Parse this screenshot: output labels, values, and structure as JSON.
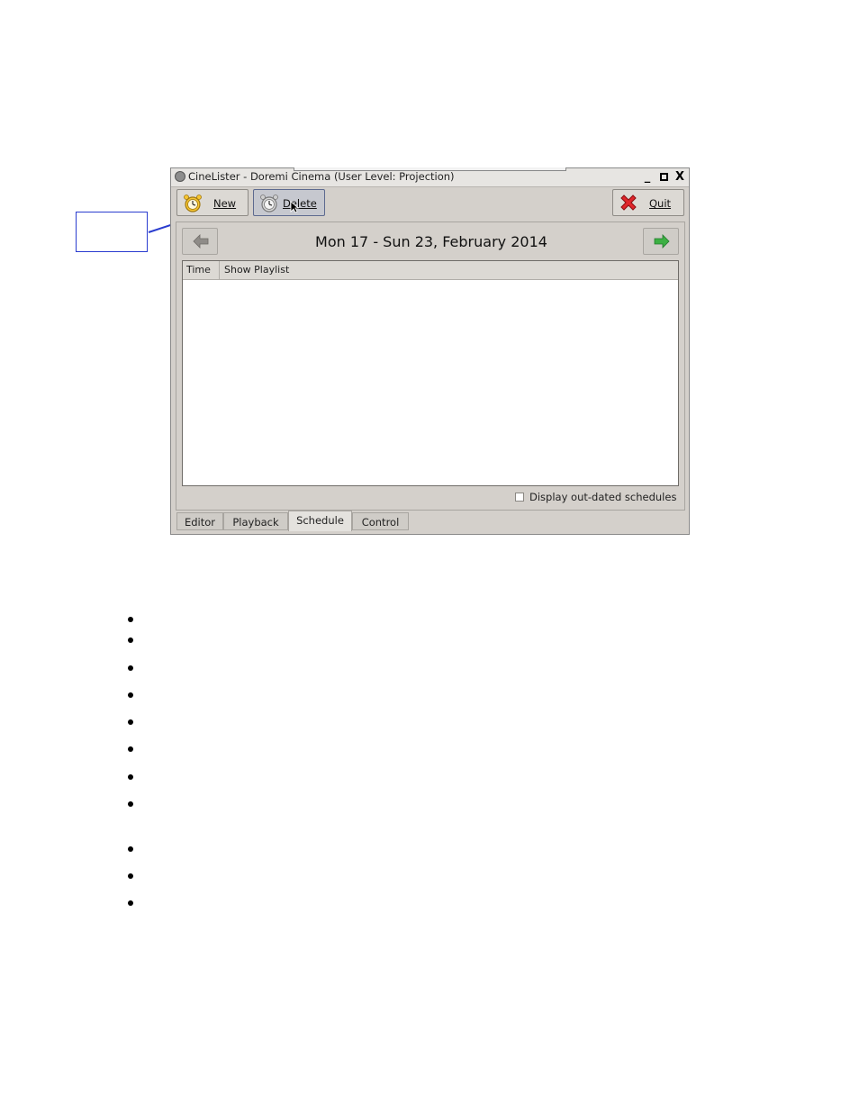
{
  "window": {
    "title": "CineLister - Doremi Cinema (User Level: Projection)",
    "controls": {
      "minimize": "_",
      "close": "X"
    }
  },
  "toolbar": {
    "new_label": "New",
    "delete_label": "Delete",
    "quit_label": "Quit"
  },
  "schedule": {
    "week_title": "Mon 17 - Sun 23, February 2014",
    "columns": [
      "Time",
      "Show Playlist"
    ],
    "rows": [],
    "outdated_label": "Display out-dated schedules",
    "outdated_checked": false
  },
  "tabs": [
    "Editor",
    "Playback",
    "Schedule",
    "Control"
  ],
  "active_tab": "Schedule",
  "colors": {
    "window_bg": "#d4d0cb",
    "annotation_blue": "#2a3ccf",
    "next_arrow_green": "#3cb043"
  },
  "bullets_count": 11
}
